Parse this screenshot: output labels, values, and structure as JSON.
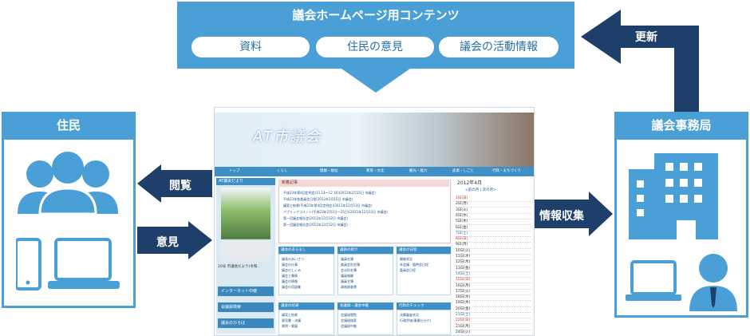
{
  "top": {
    "title": "議会ホームページ用コンテンツ",
    "pills": [
      "資料",
      "住民の意見",
      "議会の活動情報"
    ]
  },
  "left": {
    "title": "住民"
  },
  "right": {
    "title": "議会事務局"
  },
  "arrows": {
    "update": "更新",
    "view": "閲覧",
    "opinion": "意見",
    "collect": "情報収集"
  },
  "screenshot": {
    "site_title": "AT市議会",
    "nav": [
      "トップ",
      "くらし",
      "健康・福祉",
      "教育・文化",
      "観光・魅力",
      "産業・しごと",
      "行政・まちづくり"
    ],
    "sidebar_title": "AT議会だより",
    "sidebar_note": "20号 市議会だより(令和...",
    "sidebar_buttons": [
      "インターネット中継",
      "会議録検索",
      "議会のひろば"
    ],
    "news_title": "新着記事",
    "news": [
      "平成23年第4回定例会(11.14〜12.16)(2012年2月15日 市議会)",
      "平成23年各委員会日程(2012年2月15日 市議会)",
      "議案と結果(平成23年第4回定例会)(2011年12月13日 市議会)",
      "パブリックコメント(平成23年2月1日〜15日)(2011年12月13日 市議会)",
      "第一回議会報告会(2011年12月12日 市議会)",
      "第一回議会報告会(2011年12月12日 市議会)"
    ],
    "sections": [
      {
        "title": "議会のあらまし",
        "items": [
          "議長のあいさつ",
          "議会の仕事",
          "議会のしくみ",
          "議会と陳情",
          "議会の情報",
          "議会の用語集"
        ]
      },
      {
        "title": "議員の紹介",
        "items": [
          "議員名簿",
          "委員会別名簿",
          "会派別名簿",
          "議員報酬",
          "議員名簿",
          "政務調査費"
        ]
      },
      {
        "title": "議会の日程",
        "items": [
          "開催状況",
          "本会議・臨時会日程",
          "委員会日程"
        ]
      },
      {
        "title": "議会の結果",
        "items": [
          "議案と結果",
          "意見書・決議",
          "質問・質疑"
        ]
      },
      {
        "title": "会議録・議会中継",
        "items": [
          "会議録閲覧",
          "会議録検索",
          "会議録中継"
        ]
      },
      {
        "title": "行政のチェック",
        "items": [
          "決算審査状況",
          "行政評価(事業仕分け)"
        ]
      }
    ],
    "calendar": {
      "month": "2012年4月",
      "nav": "<前の月 | 次の月>",
      "days": [
        "1日(日)",
        "2日(月)",
        "3日(火)",
        "4日(水)",
        "5日(木)",
        "6日(金)",
        "7日(土)",
        "8日(日)",
        "9日(月)",
        "10日(火)",
        "11日(水)",
        "12日(木)",
        "13日(金)",
        "14日(土)",
        "15日(日)",
        "16日(月)",
        "17日(火)",
        "18日(水)",
        "19日(木)",
        "20日(金)",
        "21日(土)",
        "22日(日)",
        "23日(月)",
        "24日(火)"
      ]
    }
  },
  "colors": {
    "accent": "#4a9fd6",
    "dark_arrow": "#1f3f6b",
    "icon": "#4a9fd6"
  }
}
